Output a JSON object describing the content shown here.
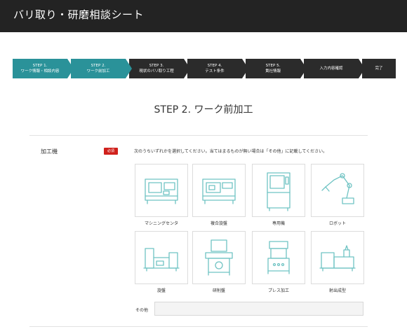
{
  "header": {
    "title": "バリ取り・研磨相談シート"
  },
  "steps": [
    {
      "line1": "STEP 1.",
      "line2": "ワーク情報・相談内容",
      "state": "done"
    },
    {
      "line1": "STEP 2.",
      "line2": "ワーク前加工",
      "state": "done"
    },
    {
      "line1": "STEP 3.",
      "line2": "現状のバリ取り工程",
      "state": "todo"
    },
    {
      "line1": "STEP 4.",
      "line2": "テスト条件",
      "state": "todo"
    },
    {
      "line1": "STEP 5.",
      "line2": "貴社情報",
      "state": "todo"
    },
    {
      "line1": "",
      "line2": "入力内容確認",
      "state": "todo"
    },
    {
      "line1": "",
      "line2": "完了",
      "state": "todo"
    }
  ],
  "main": {
    "title": "STEP 2. ワーク前加工",
    "field_label": "加工機",
    "required": "必須",
    "instruction": "次のうちいずれかを選択してください。当てはまるものが無い場合は「その他」に記載してください。",
    "options": [
      {
        "label": "マシニングセンタ",
        "icon": "machining-center-icon"
      },
      {
        "label": "複合旋盤",
        "icon": "multitasking-lathe-icon"
      },
      {
        "label": "専用機",
        "icon": "special-machine-icon"
      },
      {
        "label": "ロボット",
        "icon": "robot-arm-icon"
      },
      {
        "label": "旋盤",
        "icon": "lathe-icon"
      },
      {
        "label": "研削盤",
        "icon": "grinding-machine-icon"
      },
      {
        "label": "プレス加工",
        "icon": "press-machine-icon"
      },
      {
        "label": "射出成型",
        "icon": "injection-molding-icon"
      }
    ],
    "other": {
      "label": "その他",
      "value": "",
      "placeholder": ""
    }
  },
  "colors": {
    "header_bg": "#232323",
    "step_done": "#2a9299",
    "step_todo": "#2b2b2b",
    "required": "#d0211c",
    "icon_stroke": "#6fc3c3"
  }
}
